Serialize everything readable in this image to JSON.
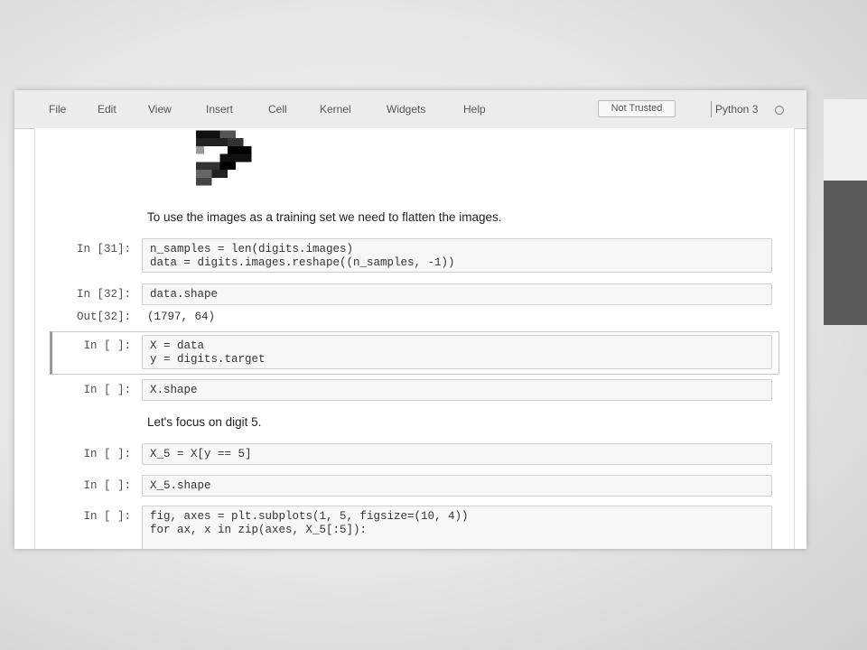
{
  "menubar": {
    "items": [
      "File",
      "Edit",
      "View",
      "Insert",
      "Cell",
      "Kernel",
      "Widgets",
      "Help"
    ],
    "trust_status": "Not Trusted",
    "kernel": "Python 3"
  },
  "cells": [
    {
      "kind": "markdown",
      "text": "To use the images as a training set we need to flatten the images."
    },
    {
      "kind": "code",
      "prompt": "In [31]:",
      "lines": [
        "n_samples = len(digits.images)",
        "data = digits.images.reshape((n_samples, -1))"
      ]
    },
    {
      "kind": "code",
      "prompt": "In [32]:",
      "lines": [
        "data.shape"
      ],
      "output_prompt": "Out[32]:",
      "output": "(1797, 64)"
    },
    {
      "kind": "code",
      "prompt": "In [ ]:",
      "lines": [
        "X = data",
        "y = digits.target"
      ]
    },
    {
      "kind": "code",
      "prompt": "In [ ]:",
      "lines": [
        "X.shape"
      ]
    },
    {
      "kind": "markdown",
      "text": "Let's focus on digit 5."
    },
    {
      "kind": "code",
      "prompt": "In [ ]:",
      "lines": [
        "X_5 = X[y == 5]"
      ]
    },
    {
      "kind": "code",
      "prompt": "In [ ]:",
      "lines": [
        "X_5.shape"
      ]
    },
    {
      "kind": "code",
      "prompt": "In [ ]:",
      "lines": [
        "fig, axes = plt.subplots(1, 5, figsize=(10, 4))",
        "for ax, x in zip(axes, X_5[:5]):"
      ]
    }
  ],
  "colors": {
    "menubar_bg": "#ececec",
    "cell_bg": "#f7f7f7",
    "cell_border": "#cfcfcf"
  }
}
